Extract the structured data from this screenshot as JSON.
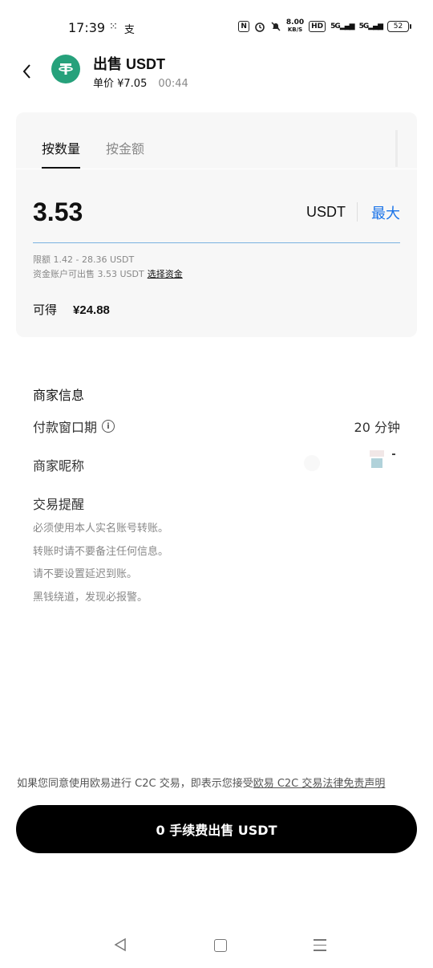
{
  "status_bar": {
    "time": "17:39",
    "left_icons": [
      "⁙",
      "支"
    ],
    "nfc": "N",
    "net_speed_value": "8.00",
    "net_speed_unit": "KB/S",
    "hd": "HD",
    "signal1": "5G",
    "signal2": "5G",
    "battery": "52"
  },
  "header": {
    "title": "出售 USDT",
    "unit_price": "单价 ¥7.05",
    "countdown": "00:44",
    "coin_symbol": "₮",
    "coin_color": "#26a17b"
  },
  "tabs": [
    {
      "label": "按数量",
      "active": true
    },
    {
      "label": "按金额",
      "active": false
    }
  ],
  "amount": {
    "value": "3.53",
    "unit": "USDT",
    "max_label": "最大",
    "accent_color": "#1a73e8"
  },
  "limits": {
    "limit_text": "限额 1.42 - 28.36 USDT",
    "available_text": "资金账户可出售  3.53 USDT",
    "select_funds_label": "选择资金"
  },
  "receive": {
    "label": "可得",
    "value": "¥24.88"
  },
  "merchant": {
    "section_title": "商家信息",
    "payment_window_label": "付款窗口期",
    "payment_window_value": "20 分钟",
    "nickname_label": "商家昵称",
    "tips_title": "交易提醒",
    "tips": [
      "必须使用本人实名账号转账。",
      "转账时请不要备注任何信息。",
      "请不要设置延迟到账。",
      "黑钱绕道，发现必报警。"
    ]
  },
  "footer": {
    "disclaimer_prefix": "如果您同意使用欧易进行 C2C 交易，即表示您接受",
    "disclaimer_link": "欧易 C2C 交易法律免责声明",
    "sell_button": "0 手续费出售 USDT"
  }
}
